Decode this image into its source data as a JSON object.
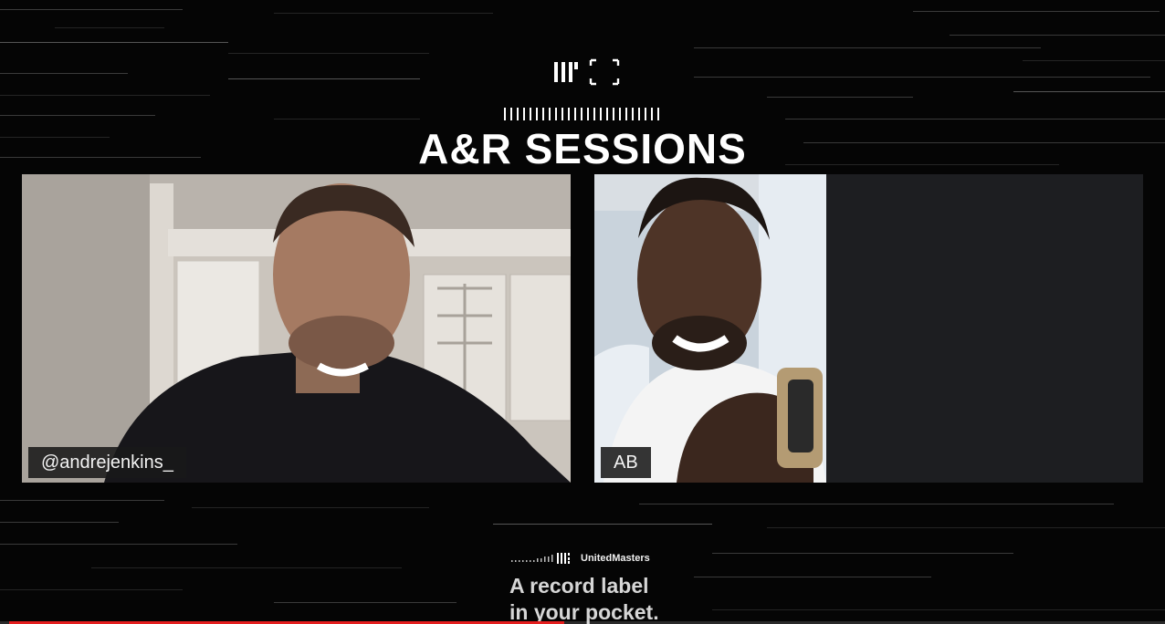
{
  "header": {
    "title": "A&R SESSIONS",
    "logo_icon": "um-bracket-logo-icon"
  },
  "participants": [
    {
      "name": "@andrejenkins_"
    },
    {
      "name": "AB"
    }
  ],
  "footer": {
    "brand": "UnitedMasters",
    "tagline_line1": "A record label",
    "tagline_line2": "in your pocket."
  },
  "video_progress": 0.48,
  "colors": {
    "background": "#050505",
    "progress": "#e41e1e",
    "tile_dark": "#1d1e21"
  }
}
